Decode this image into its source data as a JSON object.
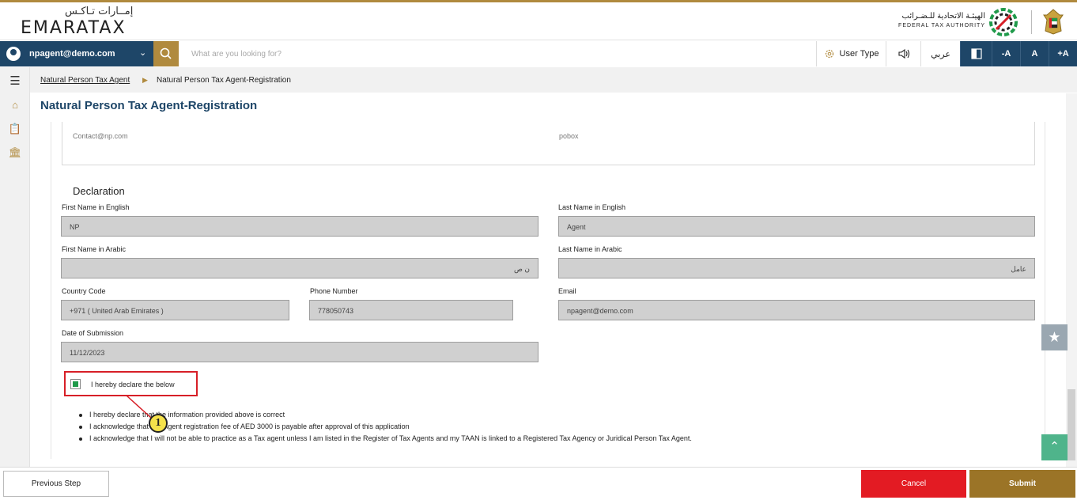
{
  "header": {
    "logo_arabic": "إمــارات تـاكـس",
    "logo_english": "EMARATAX",
    "authority_arabic": "الهيئـة الاتحادية للـضـرائب",
    "authority_english": "FEDERAL TAX AUTHORITY"
  },
  "navbar": {
    "user_email": "npagent@demo.com",
    "search_placeholder": "What are you looking for?",
    "user_type_label": "User Type",
    "language_label": "عربي",
    "font_decrease": "-A",
    "font_normal": "A",
    "font_increase": "+A"
  },
  "breadcrumb": {
    "parent": "Natural Person Tax Agent",
    "current": "Natural Person Tax Agent-Registration"
  },
  "page": {
    "title": "Natural Person Tax Agent-Registration",
    "contact_email": "Contact@np.com",
    "po_box": "pobox"
  },
  "declaration": {
    "section_title": "Declaration",
    "first_name_en_label": "First Name in English",
    "first_name_en": "NP",
    "last_name_en_label": "Last Name in English",
    "last_name_en": "Agent",
    "first_name_ar_label": "First Name in Arabic",
    "first_name_ar": "ن ص",
    "last_name_ar_label": "Last Name in Arabic",
    "last_name_ar": "عامل",
    "country_code_label": "Country Code",
    "country_code": "+971 ( United Arab Emirates )",
    "phone_label": "Phone Number",
    "phone": "778050743",
    "email_label": "Email",
    "email": "npagent@demo.com",
    "date_label": "Date of Submission",
    "date": "11/12/2023",
    "declare_checkbox_label": "I hereby declare the below",
    "declare_checked": true,
    "statements": [
      "I hereby declare that the information provided above is correct",
      "I acknowledge that Tax Agent registration fee of AED 3000 is payable after approval of this application",
      "I acknowledge that I will not be able to practice as a Tax agent unless I am listed in the Register of Tax Agents and my TAAN is linked to a Registered Tax Agency or Juridical Person Tax Agent."
    ]
  },
  "callout": {
    "number": "1"
  },
  "footer": {
    "previous_label": "Previous Step",
    "cancel_label": "Cancel",
    "submit_label": "Submit"
  },
  "colors": {
    "navy": "#1e4668",
    "gold": "#b08a3e",
    "cancel_red": "#e31b23",
    "submit_brown": "#9b7427",
    "check_green": "#1f9a4a",
    "callout_red": "#d71f27"
  }
}
